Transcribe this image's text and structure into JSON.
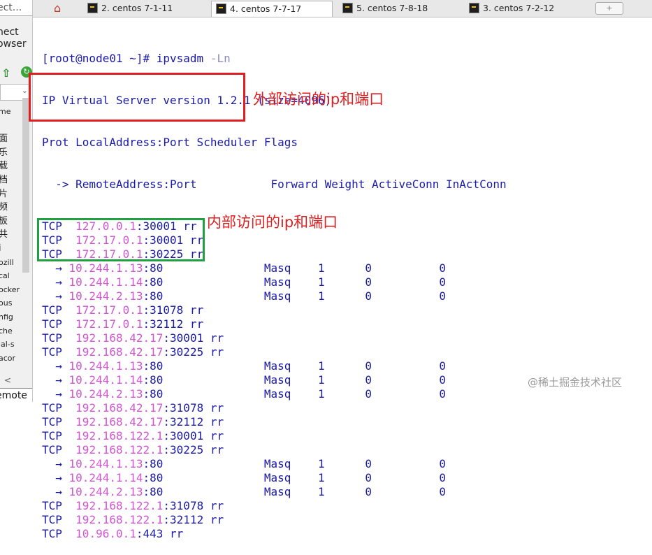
{
  "sidebar": {
    "search_text": "ect...",
    "connect_line1": "nect",
    "connect_line2": "owser",
    "items": [
      "me",
      "",
      "面",
      "乐",
      "载",
      "档",
      "片",
      "频",
      "板",
      "共",
      "i",
      "ozill",
      "cal",
      "ocker",
      "ous",
      "nfig",
      "che",
      "ial-s",
      "acor"
    ],
    "bottom_label": "emote"
  },
  "tabs": [
    {
      "label": "2. centos 7-1-11"
    },
    {
      "label": "4. centos 7-7-17"
    },
    {
      "label": "5. centos 7-8-18"
    },
    {
      "label": "3. centos 7-2-12"
    }
  ],
  "terminal": {
    "prompt": "[root@node01 ~]# ipvsadm ",
    "command_arg": "-Ln",
    "version": "IP Virtual Server version 1.2.1 (size=4096)",
    "header1": "Prot LocalAddress:Port Scheduler Flags",
    "header2": "  -> RemoteAddress:Port           Forward Weight ActiveConn InActConn",
    "rows": [
      {
        "kind": "tcp",
        "ip": "127.0.0.1",
        "rest": ":30001 rr"
      },
      {
        "kind": "tcp",
        "ip": "172.17.0.1",
        "rest": ":30001 rr"
      },
      {
        "kind": "tcp",
        "ip": "172.17.0.1",
        "rest": ":30225 rr"
      },
      {
        "kind": "real",
        "ip": "10.244.1.13",
        "rest": ":80",
        "fwd": "Masq",
        "weight": "1",
        "active": "0",
        "inact": "0"
      },
      {
        "kind": "real",
        "ip": "10.244.1.14",
        "rest": ":80",
        "fwd": "Masq",
        "weight": "1",
        "active": "0",
        "inact": "0"
      },
      {
        "kind": "real",
        "ip": "10.244.2.13",
        "rest": ":80",
        "fwd": "Masq",
        "weight": "1",
        "active": "0",
        "inact": "0"
      },
      {
        "kind": "tcp",
        "ip": "172.17.0.1",
        "rest": ":31078 rr"
      },
      {
        "kind": "tcp",
        "ip": "172.17.0.1",
        "rest": ":32112 rr"
      },
      {
        "kind": "tcp",
        "ip": "192.168.42.17",
        "rest": ":30001 rr"
      },
      {
        "kind": "tcp",
        "ip": "192.168.42.17",
        "rest": ":30225 rr"
      },
      {
        "kind": "real",
        "ip": "10.244.1.13",
        "rest": ":80",
        "fwd": "Masq",
        "weight": "1",
        "active": "0",
        "inact": "0"
      },
      {
        "kind": "real",
        "ip": "10.244.1.14",
        "rest": ":80",
        "fwd": "Masq",
        "weight": "1",
        "active": "0",
        "inact": "0"
      },
      {
        "kind": "real",
        "ip": "10.244.2.13",
        "rest": ":80",
        "fwd": "Masq",
        "weight": "1",
        "active": "0",
        "inact": "0"
      },
      {
        "kind": "tcp",
        "ip": "192.168.42.17",
        "rest": ":31078 rr"
      },
      {
        "kind": "tcp",
        "ip": "192.168.42.17",
        "rest": ":32112 rr"
      },
      {
        "kind": "tcp",
        "ip": "192.168.122.1",
        "rest": ":30001 rr"
      },
      {
        "kind": "tcp",
        "ip": "192.168.122.1",
        "rest": ":30225 rr"
      },
      {
        "kind": "real",
        "ip": "10.244.1.13",
        "rest": ":80",
        "fwd": "Masq",
        "weight": "1",
        "active": "0",
        "inact": "0"
      },
      {
        "kind": "real",
        "ip": "10.244.1.14",
        "rest": ":80",
        "fwd": "Masq",
        "weight": "1",
        "active": "0",
        "inact": "0"
      },
      {
        "kind": "real",
        "ip": "10.244.2.13",
        "rest": ":80",
        "fwd": "Masq",
        "weight": "1",
        "active": "0",
        "inact": "0"
      },
      {
        "kind": "tcp",
        "ip": "192.168.122.1",
        "rest": ":31078 rr"
      },
      {
        "kind": "tcp",
        "ip": "192.168.122.1",
        "rest": ":32112 rr"
      },
      {
        "kind": "tcp",
        "ip": "10.96.0.1",
        "rest": ":443 rr"
      }
    ]
  },
  "annotations": {
    "external_label": "外部访问的ip和端口",
    "internal_label": "内部访问的ip和端口"
  },
  "watermark": "@稀土掘金技术社区",
  "colors": {
    "terminal_text": "#1a1aa8",
    "ip_text": "#d355d3",
    "red_annotation": "#e02020",
    "green_annotation": "#20a040"
  }
}
